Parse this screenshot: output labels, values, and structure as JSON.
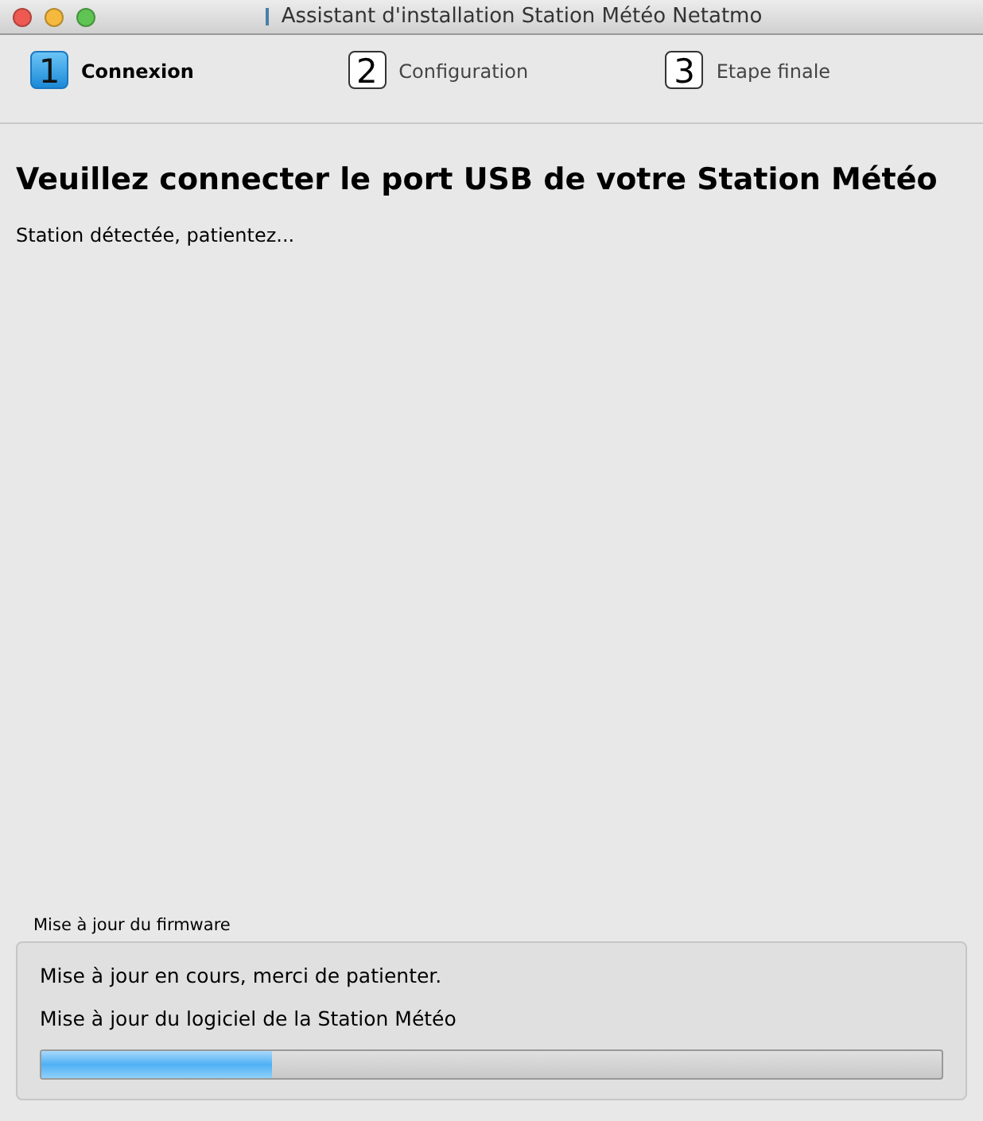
{
  "window": {
    "title": "Assistant d'installation Station Météo Netatmo"
  },
  "steps": [
    {
      "number": "1",
      "label": "Connexion",
      "selected": true
    },
    {
      "number": "2",
      "label": "Configuration",
      "selected": false
    },
    {
      "number": "3",
      "label": "Etape finale",
      "selected": false
    }
  ],
  "heading": "Veuillez connecter le port USB de votre Station Météo",
  "status": "Station détectée, patientez...",
  "firmware": {
    "title": "Mise à jour du firmware",
    "message": "Mise à jour en cours, merci de patienter.",
    "task": "Mise à jour du logiciel de la Station Météo",
    "level": 0.257
  }
}
